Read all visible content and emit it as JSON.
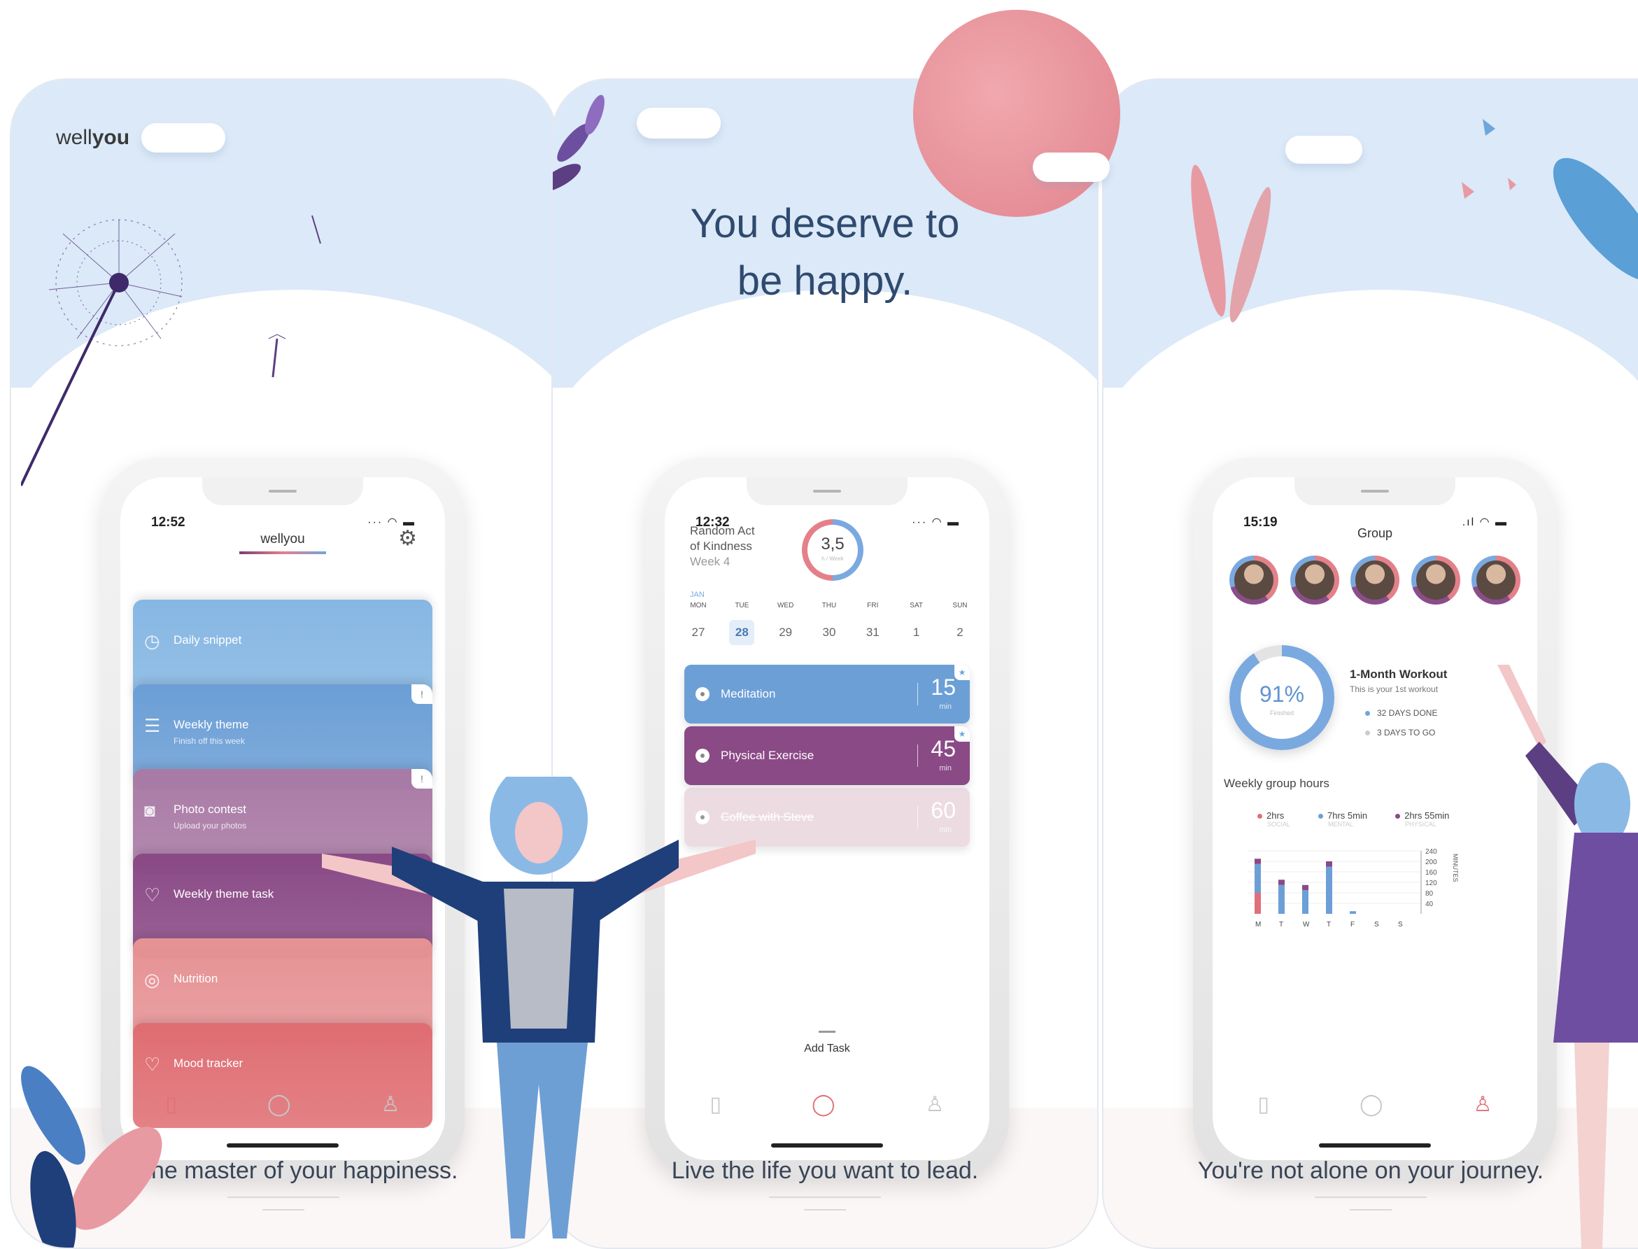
{
  "panel1": {
    "logo_light": "well",
    "logo_bold": "you",
    "caption": "Be the master of your happiness.",
    "phone": {
      "time": "12:52",
      "title": "wellyou",
      "settings_icon": "gear-icon",
      "cards": [
        {
          "label": "Daily snippet",
          "sub": "",
          "icon": "clock-icon",
          "color": "#86b7e3",
          "badge": ""
        },
        {
          "label": "Weekly theme",
          "sub": "Finish off this week",
          "icon": "document-icon",
          "color": "#6c9fd6",
          "badge": "!"
        },
        {
          "label": "Photo contest",
          "sub": "Upload your photos",
          "icon": "camera-icon",
          "color": "#a97aa5",
          "badge": "!"
        },
        {
          "label": "Weekly theme task",
          "sub": "",
          "icon": "heart-icon",
          "color": "#8a4a86",
          "badge": ""
        },
        {
          "label": "Nutrition",
          "sub": "",
          "icon": "target-icon",
          "color": "#e69294",
          "badge": ""
        },
        {
          "label": "Mood tracker",
          "sub": "",
          "icon": "heart-icon",
          "color": "#df6e73",
          "badge": ""
        }
      ]
    }
  },
  "panel2": {
    "headline_1": "You deserve to",
    "headline_2": "be happy.",
    "caption": "Live the life you want to lead.",
    "phone": {
      "time": "12:32",
      "kindness_1": "Random Act",
      "kindness_2": "of Kindness",
      "week": "Week 4",
      "ring_value": "3,5",
      "ring_sub": "h / Week",
      "month": "JAN",
      "weekdays": [
        "MON",
        "TUE",
        "WED",
        "THU",
        "FRI",
        "SAT",
        "SUN"
      ],
      "dates": [
        "27",
        "28",
        "29",
        "30",
        "31",
        "1",
        "2"
      ],
      "selected_date_index": 1,
      "tasks": [
        {
          "name": "Meditation",
          "minutes": "15",
          "unit": "min",
          "color": "#6c9fd6",
          "starred": true,
          "done": false
        },
        {
          "name": "Physical Exercise",
          "minutes": "45",
          "unit": "min",
          "color": "#8a4a86",
          "starred": true,
          "done": false
        },
        {
          "name": "Coffee with Steve",
          "minutes": "60",
          "unit": "min",
          "color": "#e9d6de",
          "starred": false,
          "done": true
        }
      ],
      "add_task": "Add Task"
    }
  },
  "panel3": {
    "caption": "You're not alone on your journey.",
    "phone": {
      "time": "15:19",
      "group_title": "Group",
      "progress_value": "91%",
      "progress_sub": "Finished",
      "progress_fraction": 0.91,
      "workout_title": "1-Month Workout",
      "workout_sub": "This is your 1st workout",
      "days_done": "32 DAYS DONE",
      "days_to_go": "3 DAYS TO GO",
      "weekly_title": "Weekly group hours",
      "legend": [
        {
          "value": "2hrs",
          "name": "SOCIAL",
          "color": "#e0707a"
        },
        {
          "value": "7hrs 5min",
          "name": "MENTAL",
          "color": "#6c9fd6"
        },
        {
          "value": "2hrs 55min",
          "name": "PHYSICAL",
          "color": "#8a4a86"
        }
      ]
    }
  },
  "chart_data": {
    "type": "bar",
    "categories": [
      "M",
      "T",
      "W",
      "T",
      "F",
      "S",
      "S"
    ],
    "series": [
      {
        "name": "SOCIAL",
        "values": [
          80,
          0,
          0,
          0,
          0,
          0,
          0
        ]
      },
      {
        "name": "MENTAL",
        "values": [
          110,
          110,
          90,
          180,
          10,
          0,
          0
        ]
      },
      {
        "name": "PHYSICAL",
        "values": [
          20,
          20,
          20,
          20,
          0,
          0,
          0
        ]
      }
    ],
    "ytick_labels": [
      "240",
      "200",
      "160",
      "120",
      "80",
      "40"
    ],
    "ylabel": "MINUTES",
    "ylim": [
      0,
      240
    ]
  }
}
